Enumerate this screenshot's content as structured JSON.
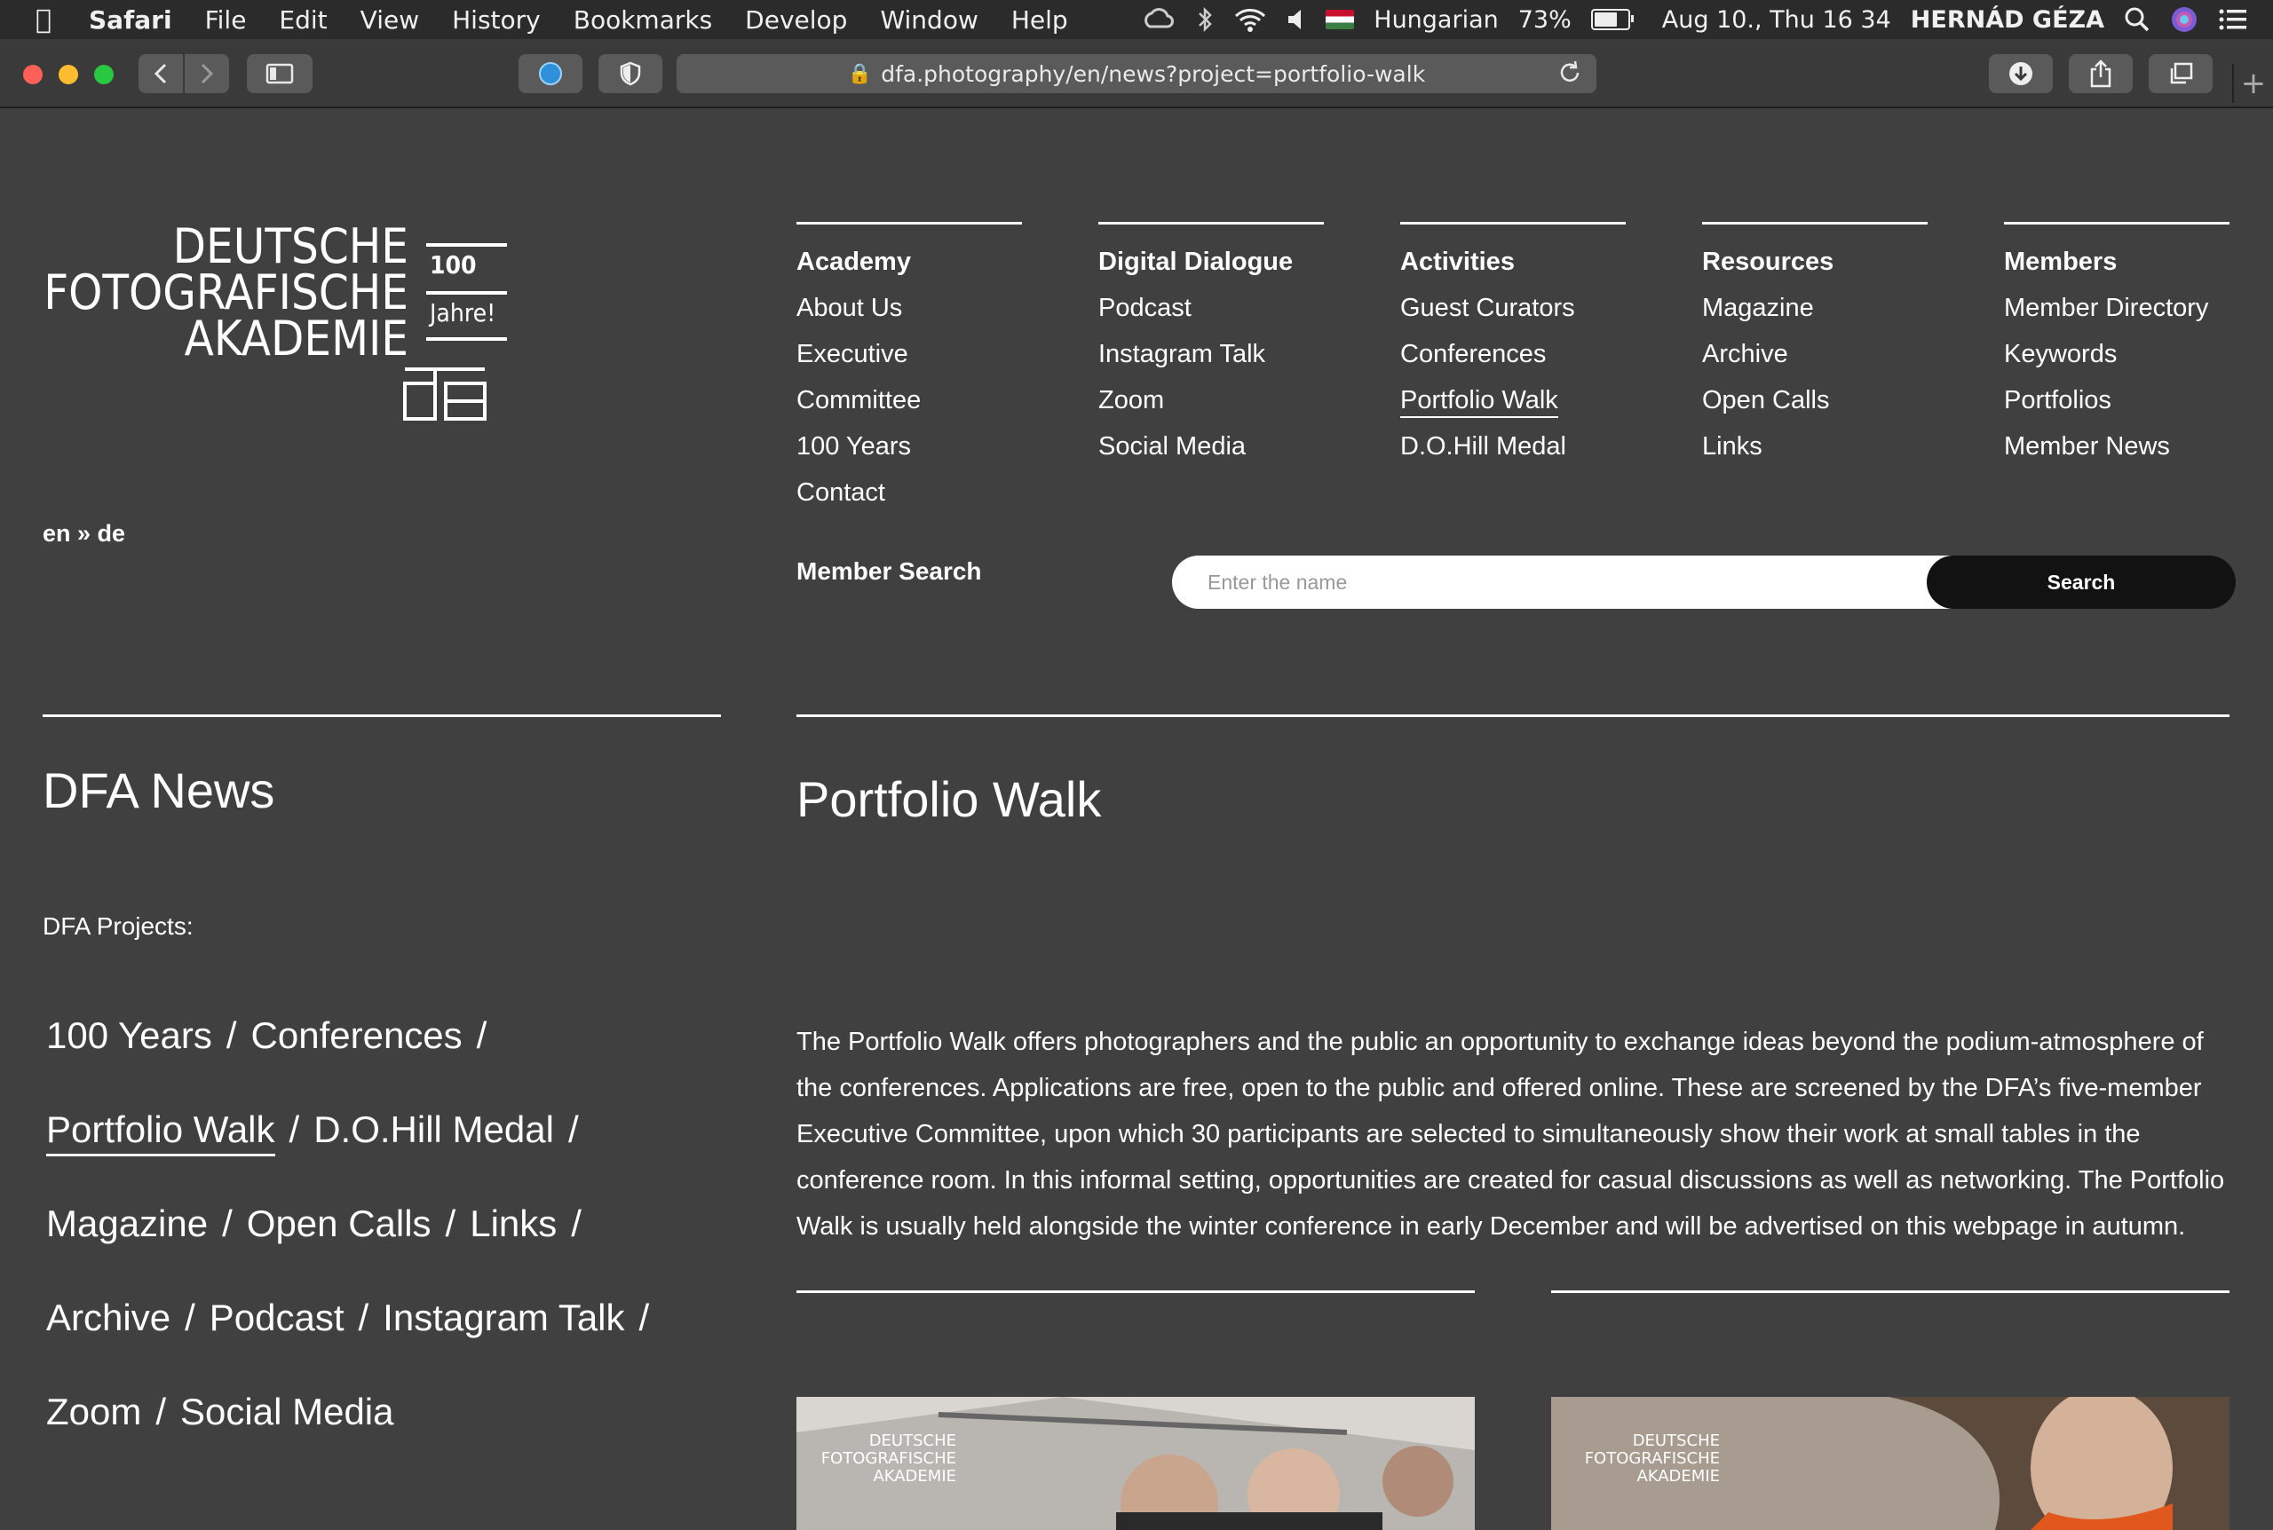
{
  "menubar": {
    "app_name": "Safari",
    "items": [
      "File",
      "Edit",
      "View",
      "History",
      "Bookmarks",
      "Develop",
      "Window",
      "Help"
    ],
    "input_language": "Hungarian",
    "battery_percent": "73%",
    "battery_level": 0.73,
    "datetime": "Aug 10., Thu  16 34",
    "user": "HERNÁD GÉZA"
  },
  "browser": {
    "url": "dfa.photography/en/news?project=portfolio-walk"
  },
  "logo": {
    "line1": "DEUTSCHE",
    "line2": "FOTOGRAFISCHE",
    "line3": "AKADEMIE",
    "badge_top": "100",
    "badge_bottom": "Jahre!"
  },
  "lang": "en » de",
  "nav": [
    {
      "head": "Academy",
      "links": [
        "About Us",
        "Executive",
        "Committee",
        "100 Years",
        "Contact"
      ]
    },
    {
      "head": "Digital Dialogue",
      "links": [
        "Podcast",
        "Instagram Talk",
        "Zoom",
        "Social Media"
      ]
    },
    {
      "head": "Activities",
      "links": [
        "Guest Curators",
        "Conferences",
        "Portfolio Walk",
        "D.O.Hill Medal"
      ]
    },
    {
      "head": "Resources",
      "links": [
        "Magazine",
        "Archive",
        "Open Calls",
        "Links"
      ]
    },
    {
      "head": "Members",
      "links": [
        "Member Directory",
        "Keywords",
        "Portfolios",
        "Member News"
      ]
    }
  ],
  "member_search": {
    "label": "Member Search",
    "placeholder": "Enter the name",
    "button": "Search"
  },
  "left": {
    "title": "DFA News",
    "projects_label": "DFA Projects:",
    "projects": [
      [
        "100 Years",
        "Conferences"
      ],
      [
        "Portfolio Walk",
        "D.O.Hill Medal"
      ],
      [
        "Magazine",
        "Open Calls",
        "Links"
      ],
      [
        "Archive",
        "Podcast",
        "Instagram Talk"
      ],
      [
        "Zoom",
        "Social Media"
      ]
    ],
    "active_project": "Portfolio Walk"
  },
  "article": {
    "title": "Portfolio Walk",
    "body": "The Portfolio Walk offers photographers and the public an opportunity to exchange ideas beyond the podium-atmosphere of the conferences. Applications are free, open to the public and offered online. These are screened by the DFA’s five-member Executive Committee, upon which 30 participants are selected to simultaneously show their work at small tables in the conference room. In this informal setting, opportunities are created for casual discussions as well as networking. The Portfolio Walk is usually held alongside the winter conference in early December and will be advertised on this webpage in autumn."
  },
  "colors": {
    "page_bg": "#404040",
    "menubar_bg": "#2b2b2b",
    "toolbar_bg": "#3a3a3a",
    "text": "#ffffff",
    "search_button_bg": "#121212"
  }
}
